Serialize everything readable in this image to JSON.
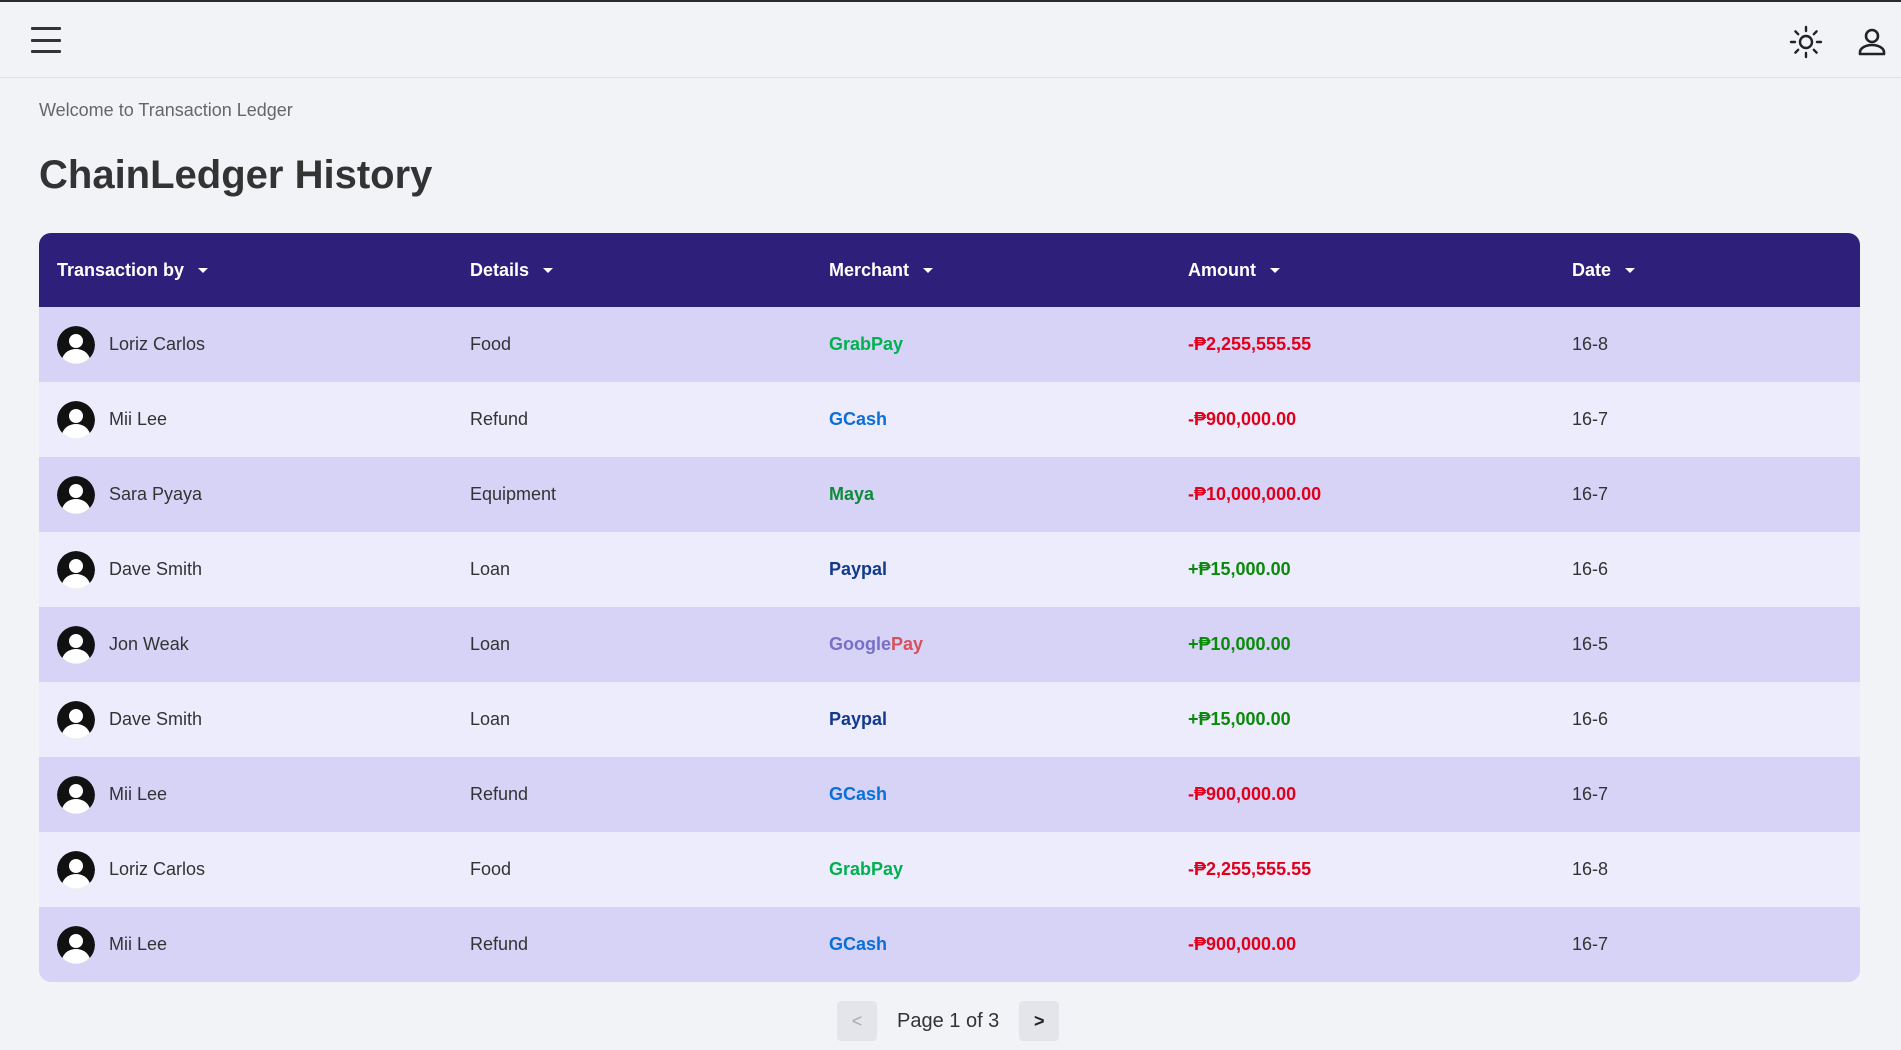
{
  "header": {
    "menu_icon": "hamburger-menu-icon",
    "theme_icon": "sun-icon",
    "user_icon": "user-icon"
  },
  "welcome": "Welcome to Transaction Ledger",
  "title": "ChainLedger History",
  "table": {
    "columns": [
      "Transaction by",
      "Details",
      "Merchant",
      "Amount",
      "Date"
    ],
    "rows": [
      {
        "name": "Loriz Carlos",
        "details": "Food",
        "merchant": "GrabPay",
        "amount": "-₱2,255,555.55",
        "date": "16-8"
      },
      {
        "name": "Mii Lee",
        "details": "Refund",
        "merchant": "GCash",
        "amount": "-₱900,000.00",
        "date": "16-7"
      },
      {
        "name": "Sara Pyaya",
        "details": "Equipment",
        "merchant": "Maya",
        "amount": "-₱10,000,000.00",
        "date": "16-7"
      },
      {
        "name": "Dave Smith",
        "details": "Loan",
        "merchant": "Paypal",
        "amount": "+₱15,000.00",
        "date": "16-6"
      },
      {
        "name": "Jon Weak",
        "details": "Loan",
        "merchant": "Google Pay",
        "amount": "+₱10,000.00",
        "date": "16-5"
      },
      {
        "name": "Dave Smith",
        "details": "Loan",
        "merchant": "Paypal",
        "amount": "+₱15,000.00",
        "date": "16-6"
      },
      {
        "name": "Mii Lee",
        "details": "Refund",
        "merchant": "GCash",
        "amount": "-₱900,000.00",
        "date": "16-7"
      },
      {
        "name": "Loriz Carlos",
        "details": "Food",
        "merchant": "GrabPay",
        "amount": "-₱2,255,555.55",
        "date": "16-8"
      },
      {
        "name": "Mii Lee",
        "details": "Refund",
        "merchant": "GCash",
        "amount": "-₱900,000.00",
        "date": "16-7"
      }
    ]
  },
  "pagination": {
    "prev": "<",
    "label": "Page 1 of 3",
    "next": ">"
  },
  "colors": {
    "header_bg": "#2d1f7a",
    "row_odd": "#d6d3f7",
    "row_even": "#edecfc",
    "negative": "#e0001b",
    "positive": "#0a8a0a"
  }
}
